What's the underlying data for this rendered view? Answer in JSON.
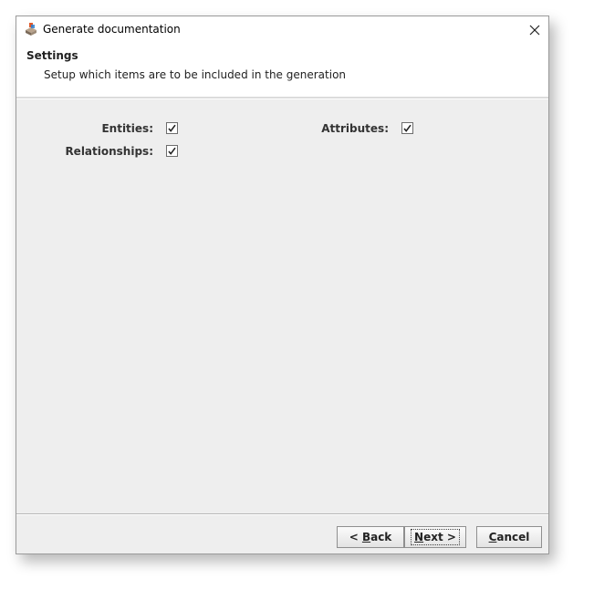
{
  "window": {
    "title": "Generate documentation",
    "app_icon": "app-logo-icon",
    "close_icon": "close-icon"
  },
  "header": {
    "title": "Settings",
    "description": "Setup which items are to be included in the generation"
  },
  "options": {
    "entities": {
      "label": "Entities:",
      "checked": true
    },
    "attributes": {
      "label": "Attributes:",
      "checked": true
    },
    "relationships": {
      "label": "Relationships:",
      "checked": true
    }
  },
  "buttons": {
    "back": {
      "prefix": "< ",
      "mnemonic": "B",
      "rest": "ack"
    },
    "next": {
      "mnemonic": "N",
      "rest": "ext >"
    },
    "cancel": {
      "mnemonic": "C",
      "rest": "ancel"
    }
  }
}
